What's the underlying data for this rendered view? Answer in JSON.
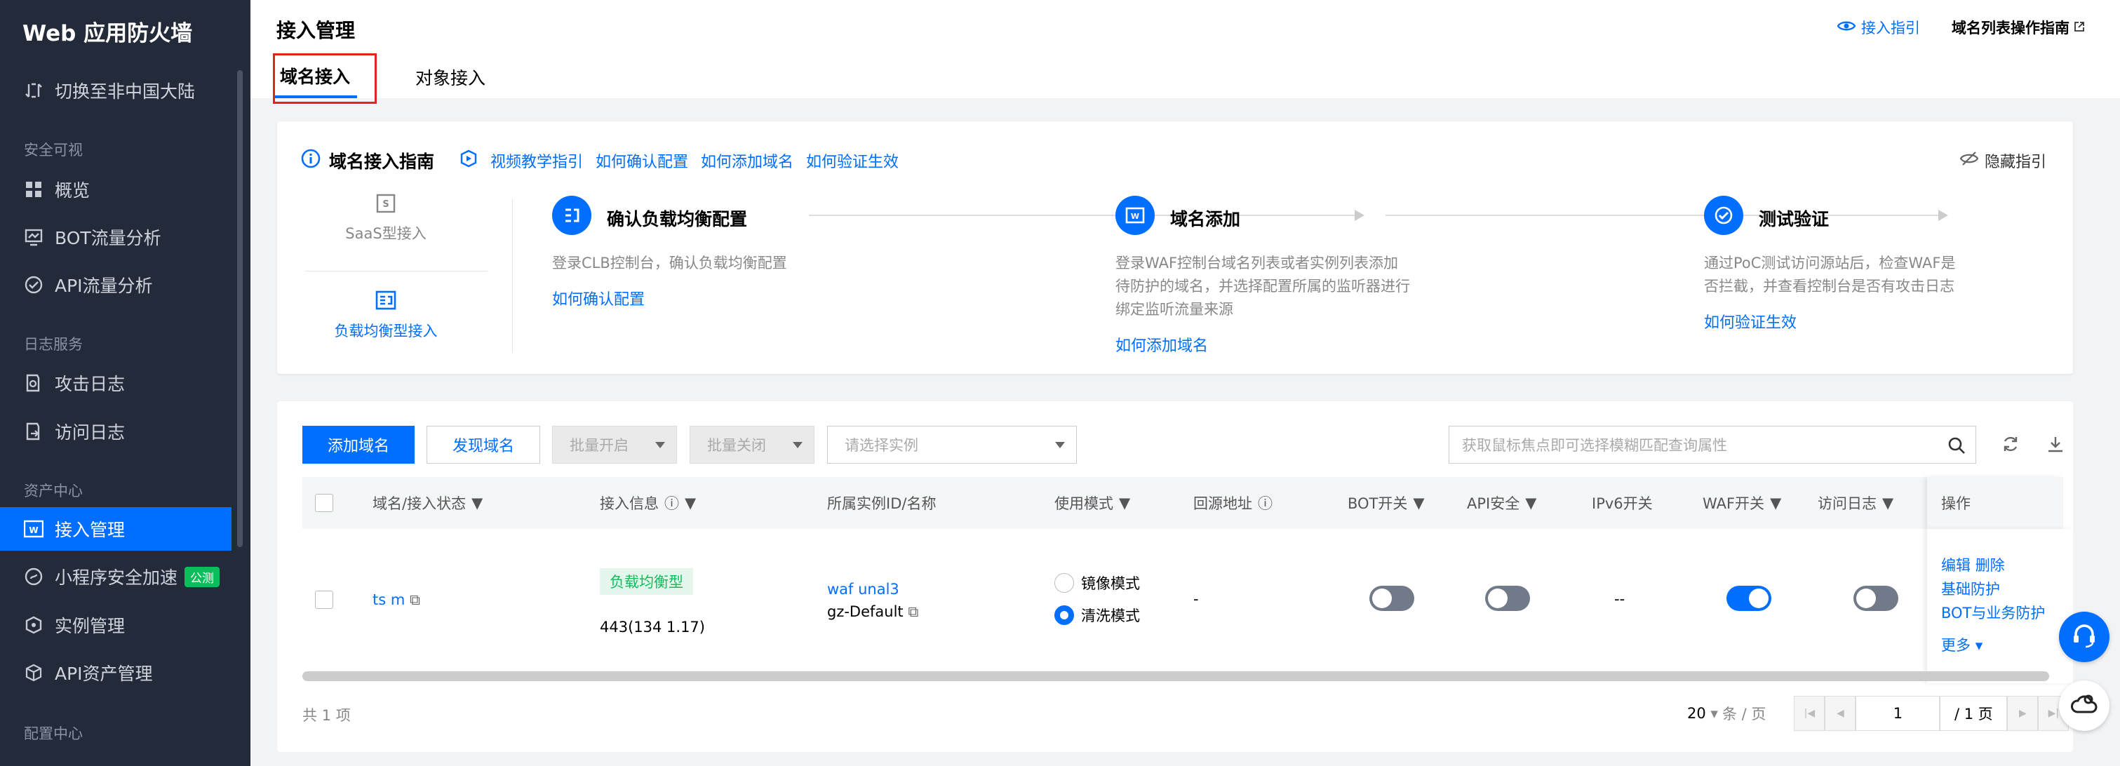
{
  "sidebar": {
    "title": "Web 应用防火墙",
    "switch_label": "切换至非中国大陆",
    "sections": {
      "visual": "安全可视",
      "logs": "日志服务",
      "assets": "资产中心",
      "config": "配置中心"
    },
    "items": [
      {
        "label": "概览",
        "icon": "grid-icon"
      },
      {
        "label": "BOT流量分析",
        "icon": "monitor-icon"
      },
      {
        "label": "API流量分析",
        "icon": "check-circle-icon"
      },
      {
        "label": "攻击日志",
        "icon": "doc-search-icon"
      },
      {
        "label": "访问日志",
        "icon": "doc-export-icon"
      },
      {
        "label": "接入管理",
        "icon": "waf-icon",
        "active": true
      },
      {
        "label": "小程序安全加速",
        "icon": "miniprogram-icon",
        "badge": "公测"
      },
      {
        "label": "实例管理",
        "icon": "instance-icon"
      },
      {
        "label": "API资产管理",
        "icon": "cube-icon"
      }
    ]
  },
  "header": {
    "title": "接入管理",
    "guide_link": "接入指引",
    "domain_guide_link": "域名列表操作指南",
    "tabs": [
      "域名接入",
      "对象接入"
    ]
  },
  "guide": {
    "title": "域名接入指南",
    "links": [
      "视频教学指引",
      "如何确认配置",
      "如何添加域名",
      "如何验证生效"
    ],
    "hide_label": "隐藏指引",
    "types": [
      "SaaS型接入",
      "负载均衡型接入"
    ],
    "steps": [
      {
        "title": "确认负载均衡配置",
        "desc": "登录CLB控制台，确认负载均衡配置",
        "link": "如何确认配置"
      },
      {
        "title": "域名添加",
        "desc": "登录WAF控制台域名列表或者实例列表添加待防护的域名，并选择配置所属的监听器进行绑定监听流量来源",
        "link": "如何添加域名"
      },
      {
        "title": "测试验证",
        "desc": "通过PoC测试访问源站后，检查WAF是否拦截，并查看控制台是否有攻击日志",
        "link": "如何验证生效"
      }
    ]
  },
  "toolbar": {
    "add_domain": "添加域名",
    "discover_domain": "发现域名",
    "batch_enable": "批量开启",
    "batch_disable": "批量关闭",
    "instance_placeholder": "请选择实例",
    "search_placeholder": "获取鼠标焦点即可选择模糊匹配查询属性"
  },
  "table": {
    "columns": [
      "域名/接入状态",
      "接入信息",
      "所属实例ID/名称",
      "使用模式",
      "回源地址",
      "BOT开关",
      "API安全",
      "IPv6开关",
      "WAF开关",
      "访问日志",
      "操作"
    ],
    "row": {
      "domain": "ts        m",
      "access_tag": "负载均衡型",
      "access_info": "443(134           1.17)",
      "instance_id": "waf                   unal3",
      "instance_name": "gz-Default",
      "mode_mirror": "镜像模式",
      "mode_clean": "清洗模式",
      "origin": "-",
      "bot": false,
      "api": false,
      "ipv6": "--",
      "waf": true,
      "access_log": false,
      "ops": {
        "edit": "编辑",
        "delete": "删除",
        "basic": "基础防护",
        "bot_biz": "BOT与业务防护",
        "more": "更多"
      }
    }
  },
  "footer": {
    "total": "共 1 项",
    "page_size": "20",
    "per_page": "条 / 页",
    "page": "1",
    "total_pages": "/ 1 页"
  },
  "colors": {
    "primary": "#006eff",
    "sidebar": "#232a3a",
    "success": "#0abf5b",
    "highlight_box": "#e1251b"
  }
}
